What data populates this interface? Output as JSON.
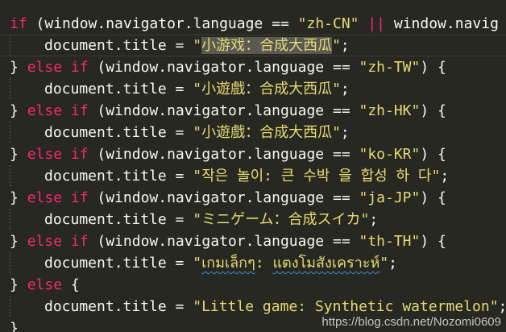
{
  "lines": [
    {
      "indent": false,
      "segments": [
        {
          "t": "if",
          "c": "kw"
        },
        {
          "t": " (window.navigator.language == ",
          "c": "plain"
        },
        {
          "t": "\"zh-CN\"",
          "c": "str"
        },
        {
          "t": " ",
          "c": "plain"
        },
        {
          "t": "||",
          "c": "kw"
        },
        {
          "t": " window.navig",
          "c": "plain"
        }
      ]
    },
    {
      "indent": true,
      "segments": [
        {
          "t": "document.title = ",
          "c": "plain"
        },
        {
          "t": "\"",
          "c": "str"
        },
        {
          "t": "小游戏：合成大西瓜",
          "c": "sel"
        },
        {
          "t": "\"",
          "c": "str"
        },
        {
          "t": ";",
          "c": "plain"
        }
      ]
    },
    {
      "indent": false,
      "segments": [
        {
          "t": "} ",
          "c": "plain"
        },
        {
          "t": "else if",
          "c": "kw"
        },
        {
          "t": " (window.navigator.language == ",
          "c": "plain"
        },
        {
          "t": "\"zh-TW\"",
          "c": "str"
        },
        {
          "t": ") {",
          "c": "plain"
        }
      ]
    },
    {
      "indent": true,
      "segments": [
        {
          "t": "document.title = ",
          "c": "plain"
        },
        {
          "t": "\"小遊戲：合成大西瓜\"",
          "c": "str"
        },
        {
          "t": ";",
          "c": "plain"
        }
      ]
    },
    {
      "indent": false,
      "segments": [
        {
          "t": "} ",
          "c": "plain"
        },
        {
          "t": "else if",
          "c": "kw"
        },
        {
          "t": " (window.navigator.language == ",
          "c": "plain"
        },
        {
          "t": "\"zh-HK\"",
          "c": "str"
        },
        {
          "t": ") {",
          "c": "plain"
        }
      ]
    },
    {
      "indent": true,
      "segments": [
        {
          "t": "document.title = ",
          "c": "plain"
        },
        {
          "t": "\"小遊戲：合成大西瓜\"",
          "c": "str"
        },
        {
          "t": ";",
          "c": "plain"
        }
      ]
    },
    {
      "indent": false,
      "segments": [
        {
          "t": "} ",
          "c": "plain"
        },
        {
          "t": "else if",
          "c": "kw"
        },
        {
          "t": " (window.navigator.language == ",
          "c": "plain"
        },
        {
          "t": "\"ko-KR\"",
          "c": "str"
        },
        {
          "t": ") {",
          "c": "plain"
        }
      ]
    },
    {
      "indent": true,
      "segments": [
        {
          "t": "document.title = ",
          "c": "plain"
        },
        {
          "t": "\"작은 놀이: 큰 수박 을 합성 하 다\"",
          "c": "str"
        },
        {
          "t": ";",
          "c": "plain"
        }
      ]
    },
    {
      "indent": false,
      "segments": [
        {
          "t": "} ",
          "c": "plain"
        },
        {
          "t": "else if",
          "c": "kw"
        },
        {
          "t": " (window.navigator.language == ",
          "c": "plain"
        },
        {
          "t": "\"ja-JP\"",
          "c": "str"
        },
        {
          "t": ") {",
          "c": "plain"
        }
      ]
    },
    {
      "indent": true,
      "segments": [
        {
          "t": "document.title = ",
          "c": "plain"
        },
        {
          "t": "\"ミニゲーム：合成スイカ\"",
          "c": "str"
        },
        {
          "t": ";",
          "c": "plain"
        }
      ]
    },
    {
      "indent": false,
      "segments": [
        {
          "t": "} ",
          "c": "plain"
        },
        {
          "t": "else if",
          "c": "kw"
        },
        {
          "t": " (window.navigator.language == ",
          "c": "plain"
        },
        {
          "t": "\"th-TH\"",
          "c": "str"
        },
        {
          "t": ") {",
          "c": "plain"
        }
      ]
    },
    {
      "indent": true,
      "segments": [
        {
          "t": "document.title = ",
          "c": "plain"
        },
        {
          "t": "\"",
          "c": "str"
        },
        {
          "t": "เกมเล็กๆ",
          "c": "str squiggle"
        },
        {
          "t": ": ",
          "c": "str"
        },
        {
          "t": "แตงโมสังเคราะห์",
          "c": "str squiggle"
        },
        {
          "t": "\"",
          "c": "str"
        },
        {
          "t": ";",
          "c": "plain"
        }
      ]
    },
    {
      "indent": false,
      "segments": [
        {
          "t": "} ",
          "c": "plain"
        },
        {
          "t": "else",
          "c": "kw"
        },
        {
          "t": " {",
          "c": "plain"
        }
      ]
    },
    {
      "indent": true,
      "segments": [
        {
          "t": "document.title = ",
          "c": "plain"
        },
        {
          "t": "\"Little game: Synthetic watermelon\"",
          "c": "str"
        },
        {
          "t": ";",
          "c": "plain"
        }
      ]
    },
    {
      "indent": false,
      "segments": [
        {
          "t": "}",
          "c": "plain"
        }
      ]
    }
  ],
  "watermark": "https://blog.csdn.net/Nozomi0609",
  "colors": {
    "background": "#272822",
    "keyword": "#f92672",
    "string": "#e6db74",
    "text": "#f8f8f2",
    "selection": "#5a5a52"
  }
}
